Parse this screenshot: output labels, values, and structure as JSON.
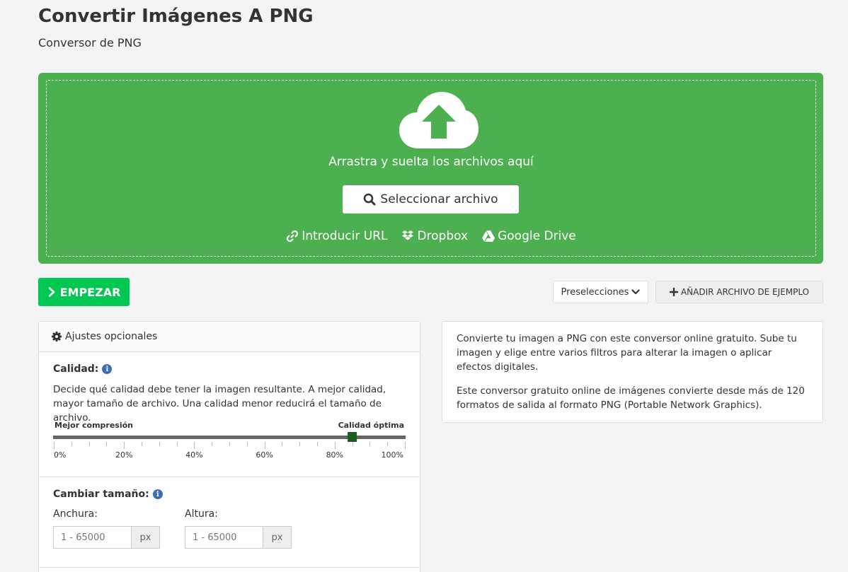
{
  "header": {
    "title": "Convertir Imágenes A PNG",
    "subtitle": "Conversor de PNG"
  },
  "dropzone": {
    "drop_text": "Arrastra y suelta los archivos aquí",
    "select_label": "Seleccionar archivo",
    "sources": [
      {
        "label": "Introducir URL",
        "icon": "link-icon"
      },
      {
        "label": "Dropbox",
        "icon": "dropbox-icon"
      },
      {
        "label": "Google Drive",
        "icon": "google-drive-icon"
      }
    ],
    "color": "#4caf50"
  },
  "actions": {
    "start_label": "EMPEZAR",
    "presets_label": "Preselecciones",
    "add_sample_label": "AÑADIR ARCHIVO DE EJEMPLO",
    "start_color": "#00c853"
  },
  "settings": {
    "header": "Ajustes opcionales",
    "quality": {
      "label": "Calidad:",
      "description": "Decide qué calidad debe tener la imagen resultante. A mejor calidad, mayor tamaño de archivo. Una calidad menor reducirá el tamaño de archivo.",
      "left_label": "Mejor compresión",
      "right_label": "Calidad óptima",
      "ticks": [
        "0%",
        "20%",
        "40%",
        "60%",
        "80%",
        "100%"
      ],
      "value_percent": 85
    },
    "resize": {
      "label": "Cambiar tamaño:",
      "width_label": "Anchura:",
      "height_label": "Altura:",
      "width_placeholder": "1 - 65000",
      "height_placeholder": "1 - 65000",
      "unit": "px"
    }
  },
  "info": {
    "paragraph1": "Convierte tu imagen a PNG con este conversor online gratuito. Sube tu imagen y elige entre varios filtros para alterar la imagen o aplicar efectos digitales.",
    "paragraph2": "Este conversor gratuito online de imágenes convierte desde más de 120 formatos de salida al formato PNG (Portable Network Graphics)."
  }
}
